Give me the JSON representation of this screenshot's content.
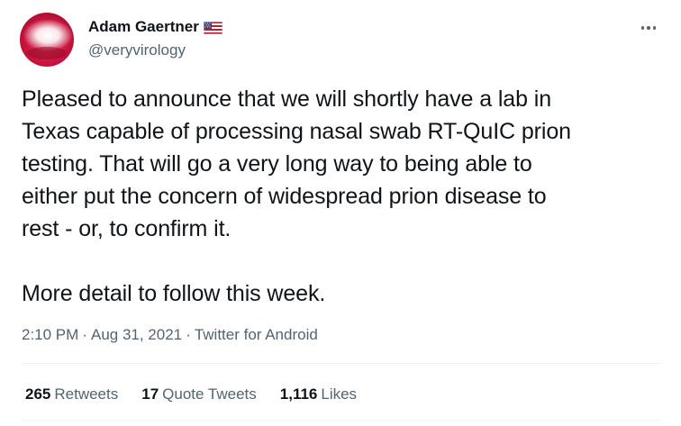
{
  "author": {
    "display_name": "Adam Gaertner",
    "handle": "@veryvirology",
    "flag_icon": "us-flag-icon"
  },
  "tweet": {
    "text": "Pleased to announce that we will shortly have a lab in\nTexas capable of processing nasal swab RT-QuIC prion\ntesting. That will go a very long way to being able to\neither put the concern of widespread prion disease to\nrest - or, to confirm it.\n\nMore detail to follow this week."
  },
  "meta": {
    "time": "2:10 PM",
    "separator": "·",
    "date": "Aug 31, 2021",
    "separator2": "·",
    "source": "Twitter for Android"
  },
  "stats": {
    "retweets_count": "265",
    "retweets_label": "Retweets",
    "quotes_count": "17",
    "quotes_label": "Quote Tweets",
    "likes_count": "1,116",
    "likes_label": "Likes"
  },
  "colors": {
    "text_primary": "#0f1419",
    "text_secondary": "#536471",
    "divider": "#eff3f4"
  }
}
